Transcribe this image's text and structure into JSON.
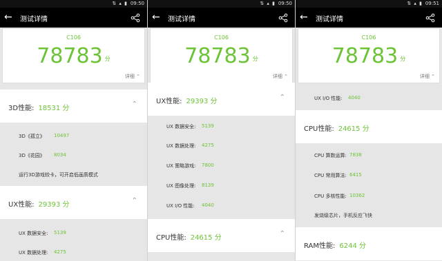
{
  "statusbar": {
    "time_1": "09:50",
    "time_2": "09:50",
    "time_3": "09:51",
    "icons": "⇅ ▴ ▮"
  },
  "appbar": {
    "title": "测试详情"
  },
  "score": {
    "device": "C106",
    "value": "78783",
    "unit": "分",
    "detail": "详细"
  },
  "pane1": {
    "section_3d": {
      "label": "3D性能:",
      "value": "18531 分"
    },
    "rows_3d": [
      {
        "label": "3D《孤立》",
        "value": "10497"
      },
      {
        "label": "3D《花园》",
        "value": "8034"
      }
    ],
    "note_3d": "运行3D游戏较卡，可开启低画质模式",
    "section_ux": {
      "label": "UX性能:",
      "value": "29393 分"
    },
    "rows_ux": [
      {
        "label": "UX 数据安全:",
        "value": "5139"
      },
      {
        "label": "UX 数据处理:",
        "value": "4275"
      }
    ]
  },
  "pane2": {
    "section_ux": {
      "label": "UX性能:",
      "value": "29393 分"
    },
    "rows_ux": [
      {
        "label": "UX 数据安全:",
        "value": "5139"
      },
      {
        "label": "UX 数据处理:",
        "value": "4275"
      },
      {
        "label": "UX 策略游戏:",
        "value": "7800"
      },
      {
        "label": "UX 图像处理:",
        "value": "8139"
      },
      {
        "label": "UX I/O 性能:",
        "value": "4040"
      }
    ],
    "section_cpu": {
      "label": "CPU性能:",
      "value": "24615 分"
    }
  },
  "pane3": {
    "row_io": {
      "label": "UX I/O 性能:",
      "value": "4040"
    },
    "section_cpu": {
      "label": "CPU性能:",
      "value": "24615 分"
    },
    "rows_cpu": [
      {
        "label": "CPU 算数运算:",
        "value": "7838"
      },
      {
        "label": "CPU 常用算法:",
        "value": "6415"
      },
      {
        "label": "CPU 多核性能:",
        "value": "10362"
      }
    ],
    "note_cpu": "发烧级芯片，手机反应飞快",
    "section_ram": {
      "label": "RAM性能:",
      "value": "6244 分"
    }
  },
  "colors": {
    "accent": "#6bc335",
    "bar": "#000000",
    "background": "#e6e6e6"
  }
}
